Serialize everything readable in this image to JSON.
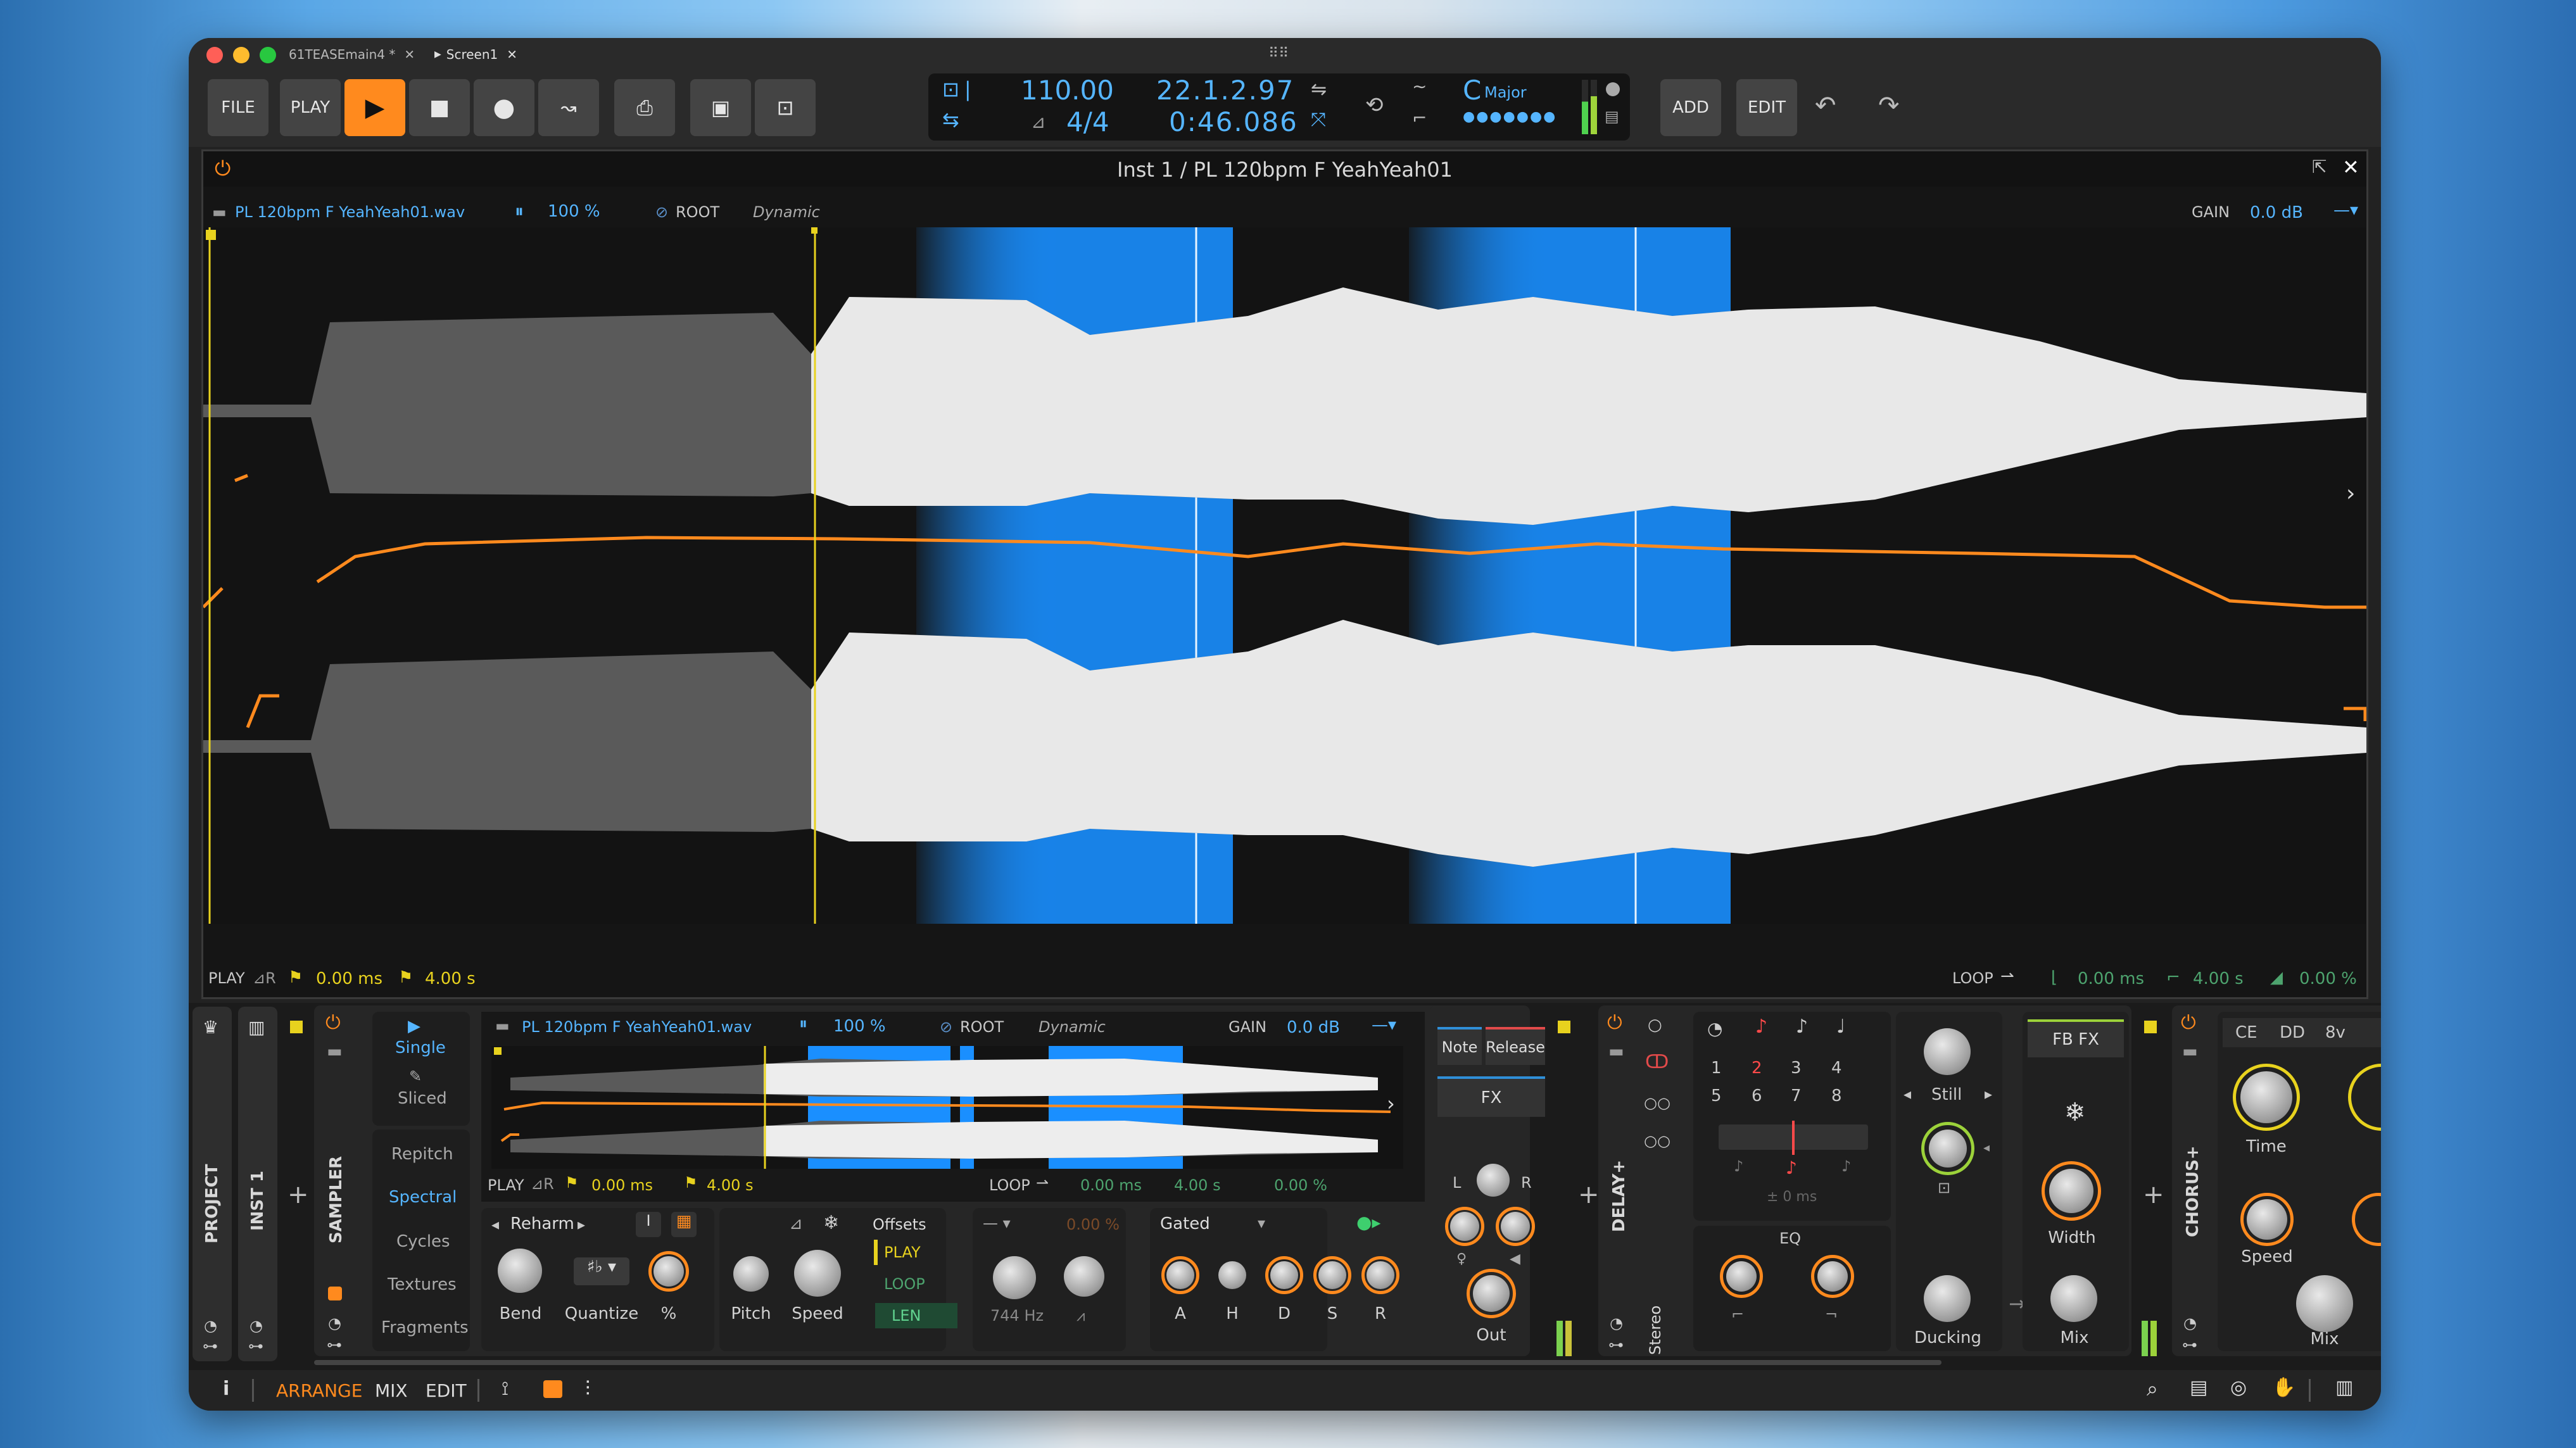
{
  "tabs": {
    "project_tab": "61TEASEmain4 *",
    "screen_tab": "Screen1"
  },
  "toolbar": {
    "file": "FILE",
    "play": "PLAY",
    "add": "ADD",
    "edit": "EDIT"
  },
  "transport": {
    "tempo": "110.00",
    "time_sig": "4/4",
    "position_bars": "22.1.2.97",
    "position_time": "0:46.086",
    "key_root": "C",
    "key_scale": "Major"
  },
  "editor": {
    "title": "Inst 1 / PL 120bpm F YeahYeah01",
    "file": "PL 120bpm F YeahYeah01.wav",
    "speed": "100 %",
    "root": "ROOT",
    "mode": "Dynamic",
    "gain_label": "GAIN",
    "gain_value": "0.0 dB",
    "play_label": "PLAY",
    "start": "0.00 ms",
    "length": "4.00 s",
    "loop_label": "LOOP",
    "loop_start": "0.00 ms",
    "loop_len": "4.00 s",
    "loop_pct": "0.00 %"
  },
  "sampler": {
    "title": "SAMPLER",
    "modes": [
      "Single",
      "Sliced"
    ],
    "algorithms": [
      "Repitch",
      "Spectral",
      "Cycles",
      "Textures",
      "Fragments"
    ],
    "reharm": "Reharm",
    "knob_bend": "Bend",
    "knob_quantize": "Quantize",
    "knob_pct": "%",
    "knob_pitch": "Pitch",
    "knob_speed": "Speed",
    "offsets": "Offsets",
    "off_play": "PLAY",
    "off_loop": "LOOP",
    "off_len": "LEN",
    "filter_pct": "0.00 %",
    "filter_hz": "744 Hz",
    "gated": "Gated",
    "env": [
      "A",
      "H",
      "D",
      "S",
      "R"
    ],
    "note_btn": "Note",
    "release_btn": "Release",
    "fx_btn": "FX",
    "out": "Out",
    "lr": [
      "L",
      "R"
    ]
  },
  "tracks": {
    "project": "PROJECT",
    "inst": "INST 1"
  },
  "delay": {
    "title": "DELAY+",
    "stereo": "Stereo",
    "grid": [
      "1",
      "2",
      "3",
      "4",
      "5",
      "6",
      "7",
      "8"
    ],
    "ms": "± 0 ms",
    "eq": "EQ",
    "still": "Still",
    "ducking": "Ducking",
    "fbfx": "FB FX",
    "width": "Width",
    "mix": "Mix"
  },
  "chorus": {
    "title": "CHORUS+",
    "tabs": [
      "CE",
      "DD",
      "8v"
    ],
    "time": "Time",
    "speed": "Speed",
    "mix": "Mix"
  },
  "statusbar": {
    "info": "i",
    "arrange": "ARRANGE",
    "mix": "MIX",
    "edit": "EDIT"
  },
  "colors": {
    "accent": "#ff8a1e",
    "selection": "#1a9bff",
    "text_blue": "#55b5ff",
    "marker": "#e8d21e"
  }
}
